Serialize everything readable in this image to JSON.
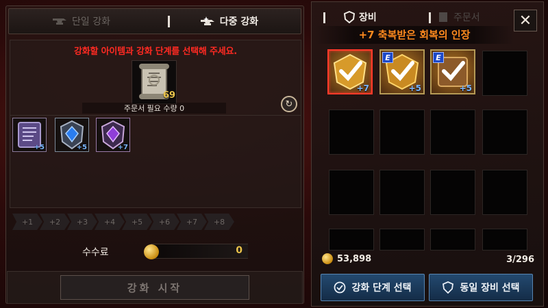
{
  "tabs": {
    "single": "단일 강화",
    "multi": "다중 강화",
    "active": "multi"
  },
  "instruction": "강화할 아이템과 강화 단계를 선택해 주세요.",
  "scroll": {
    "count": "69",
    "required_label": "주문서 필요 수량 0",
    "icon": "scroll-icon"
  },
  "selected_items": [
    {
      "icon": "spellbook-icon",
      "level": "+5",
      "border": "#8a7a9a"
    },
    {
      "icon": "blue-gem-shield-icon",
      "level": "+5",
      "border": "#7d8a9a"
    },
    {
      "icon": "purple-gem-shield-icon",
      "level": "+7",
      "border": "#9a7aa8"
    }
  ],
  "levels": [
    "+1",
    "+2",
    "+3",
    "+4",
    "+5",
    "+6",
    "+7",
    "+8"
  ],
  "fee": {
    "label": "수수료",
    "value": "0"
  },
  "start_button": "강화 시작",
  "inventory": {
    "tabs": {
      "equipment": "장비",
      "scroll": "주문서",
      "active": "equipment"
    },
    "selected_title": "+7 축복받은 회복의 인장",
    "items": [
      {
        "icon": "seal-checkmark-icon",
        "level": "+7",
        "badge": "",
        "selected": true
      },
      {
        "icon": "seal-checkmark-icon",
        "level": "+5",
        "badge": "E",
        "selected": false
      },
      {
        "icon": "seal-checkmark-icon",
        "level": "+5",
        "badge": "E",
        "selected": false
      }
    ],
    "gold": "53,898",
    "capacity": "3/296"
  },
  "buttons": {
    "select_level": "강화 단계 선택",
    "select_same_equipment": "동일 장비 선택"
  },
  "colors": {
    "instruction": "#ff2a22",
    "selected_title": "#ff8a1e",
    "level_text": "#7ab6ff",
    "gold_text": "#e9c24a",
    "action_button": "#1f4266"
  }
}
